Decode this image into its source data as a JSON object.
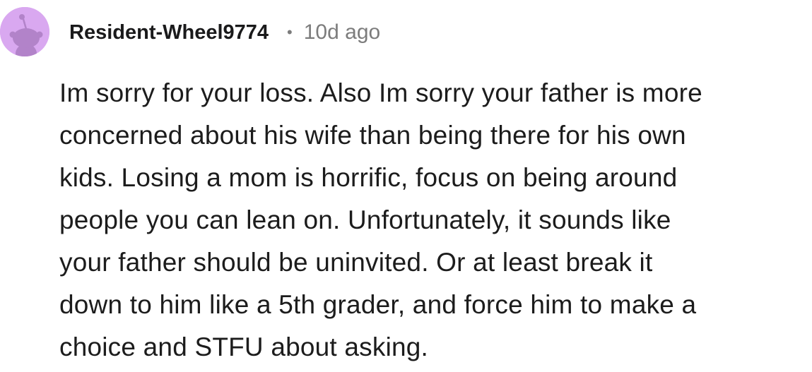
{
  "comment": {
    "author": "Resident-Wheel9774",
    "separator": "•",
    "age": "10d ago",
    "avatar_icon": "reddit-snoo-avatar-icon",
    "avatar_color": "#d9a8f0",
    "body_lines": [
      "Im sorry for your loss. Also Im sorry your father is more",
      "concerned about his wife than being there for his own",
      "kids. Losing a mom is horrific, focus on being around",
      "people you can lean on. Unfortunately, it sounds like",
      "your father should be uninvited. Or at least break it",
      "down to him like a 5th grader, and force him to make a",
      "choice and STFU about asking."
    ]
  }
}
